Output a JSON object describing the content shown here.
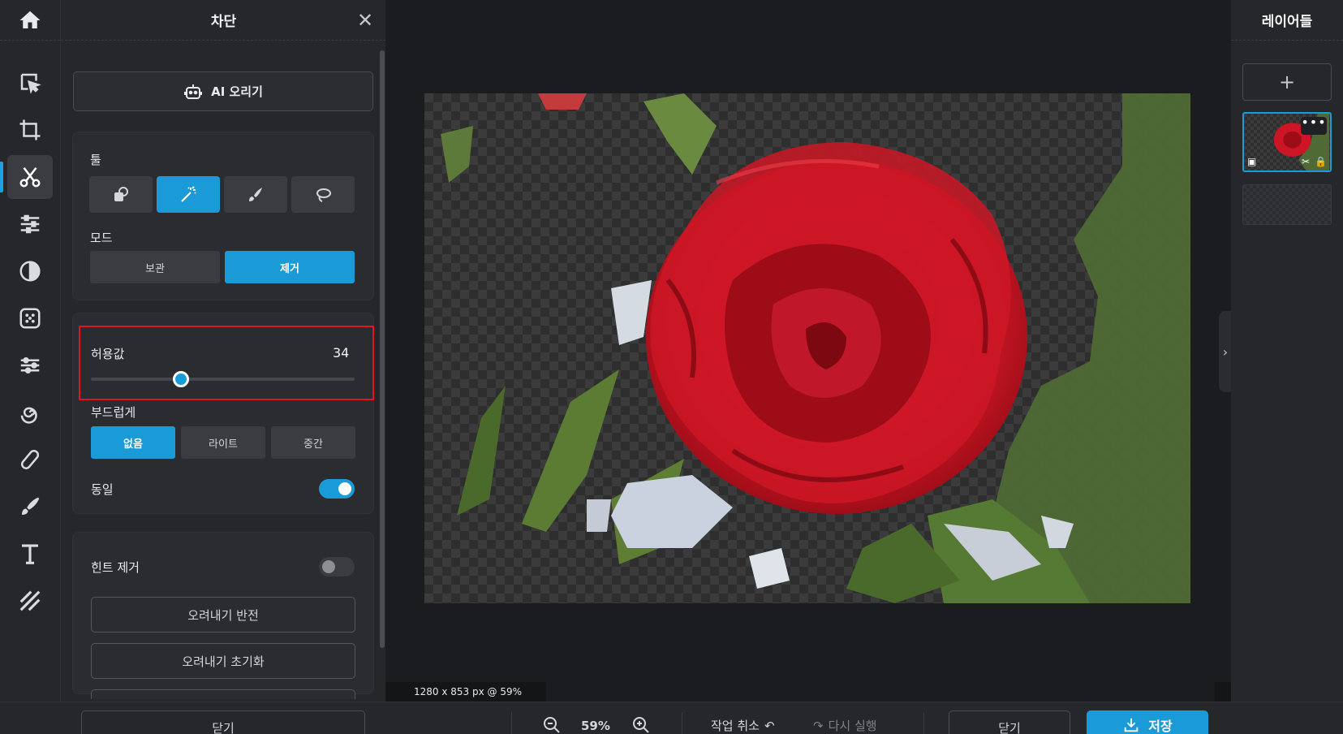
{
  "panel": {
    "title": "차단",
    "ai_button": "AI 오리기",
    "tool_label": "툴",
    "mode_label": "모드",
    "mode_keep": "보관",
    "mode_remove": "제거",
    "tolerance_label": "허용값",
    "tolerance_value": "34",
    "tolerance_fraction": 0.34,
    "smooth_label": "부드럽게",
    "smooth_none": "없음",
    "smooth_light": "라이트",
    "smooth_medium": "중간",
    "same_label": "동일",
    "same_enabled": true,
    "hint_label": "힌트 제거",
    "hint_enabled": false,
    "invert_button": "오려내기 반전",
    "reset_button": "오려내기 초기화",
    "close_button": "닫기"
  },
  "canvas": {
    "dimensions": "1280 x 853 px @ 59%"
  },
  "layers": {
    "title": "레이어들",
    "add": "+"
  },
  "bottom": {
    "zoom": "59%",
    "undo": "작업 취소",
    "redo": "다시 실행",
    "close": "닫기",
    "save": "저장"
  },
  "colors": {
    "accent": "#1a9bd7",
    "highlight": "#e0141a"
  }
}
